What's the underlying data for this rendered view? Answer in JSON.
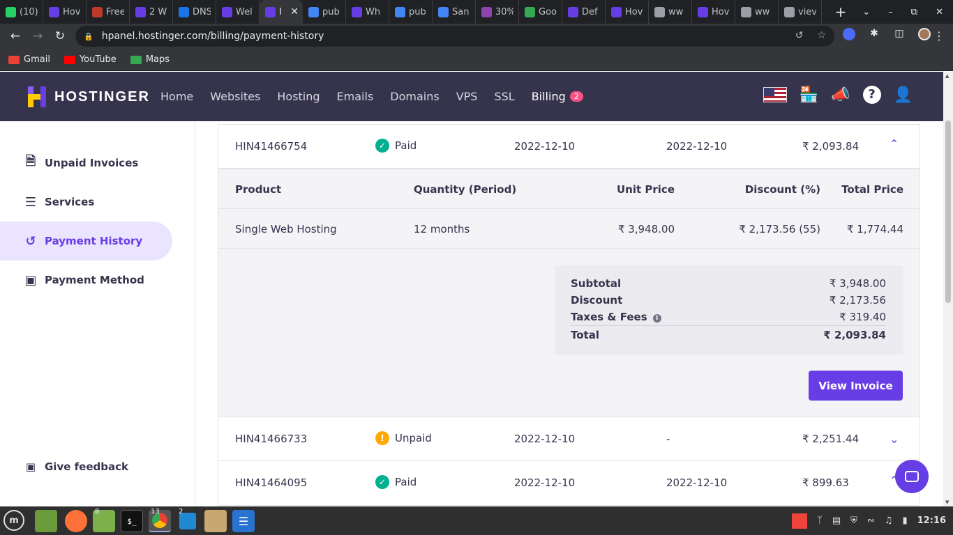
{
  "browser": {
    "tabs": [
      {
        "label": "(10)",
        "fav": "whatsapp-icon",
        "color": "#25d366"
      },
      {
        "label": "Hov",
        "fav": "hostinger-icon",
        "color": "#673de6"
      },
      {
        "label": "Free",
        "fav": "generic-icon",
        "color": "#c0392b"
      },
      {
        "label": "2 W",
        "fav": "hostinger-icon",
        "color": "#673de6"
      },
      {
        "label": "DNS",
        "fav": "shield-icon",
        "color": "#1a73e8"
      },
      {
        "label": "Wel",
        "fav": "hostinger-icon",
        "color": "#673de6"
      },
      {
        "label": "I",
        "fav": "hostinger-icon",
        "color": "#673de6",
        "active": true
      },
      {
        "label": "pub",
        "fav": "globe-icon",
        "color": "#4285f4"
      },
      {
        "label": "Wh",
        "fav": "hostinger-icon",
        "color": "#673de6"
      },
      {
        "label": "pub",
        "fav": "globe-icon",
        "color": "#4285f4"
      },
      {
        "label": "San",
        "fav": "globe-icon",
        "color": "#4285f4"
      },
      {
        "label": "30%",
        "fav": "triangle-icon",
        "color": "#8e44ad"
      },
      {
        "label": "Goo",
        "fav": "google-icon",
        "color": "#34a853"
      },
      {
        "label": "Def",
        "fav": "hostinger-icon",
        "color": "#673de6"
      },
      {
        "label": "Hov",
        "fav": "hostinger-icon",
        "color": "#673de6"
      },
      {
        "label": "ww",
        "fav": "globe-icon",
        "color": "#9aa0a6"
      },
      {
        "label": "Hov",
        "fav": "hostinger-icon",
        "color": "#673de6"
      },
      {
        "label": "ww",
        "fav": "globe-icon",
        "color": "#9aa0a6"
      },
      {
        "label": "viev",
        "fav": "globe-icon",
        "color": "#9aa0a6"
      }
    ],
    "url": "hpanel.hostinger.com/billing/payment-history",
    "bookmarks": [
      {
        "label": "Gmail",
        "color": "#ea4335"
      },
      {
        "label": "YouTube",
        "color": "#ff0000"
      },
      {
        "label": "Maps",
        "color": "#34a853"
      }
    ]
  },
  "header": {
    "logo": "HOSTINGER",
    "nav": [
      "Home",
      "Websites",
      "Hosting",
      "Emails",
      "Domains",
      "VPS",
      "SSL"
    ],
    "billing_label": "Billing",
    "billing_badge": "2"
  },
  "sidebar": {
    "items": [
      {
        "label": "Unpaid Invoices",
        "icon": "document-icon"
      },
      {
        "label": "Services",
        "icon": "list-icon"
      },
      {
        "label": "Payment History",
        "icon": "history-icon",
        "active": true
      },
      {
        "label": "Payment Method",
        "icon": "wallet-icon"
      }
    ],
    "feedback": "Give feedback"
  },
  "invoices": [
    {
      "id": "HIN41466754",
      "status": "Paid",
      "date1": "2022-12-10",
      "date2": "2022-12-10",
      "amount": "₹ 2,093.84",
      "expanded": true
    },
    {
      "id": "HIN41466733",
      "status": "Unpaid",
      "date1": "2022-12-10",
      "date2": "-",
      "amount": "₹ 2,251.44"
    },
    {
      "id": "HIN41464095",
      "status": "Paid",
      "date1": "2022-12-10",
      "date2": "2022-12-10",
      "amount": "₹ 899.63"
    }
  ],
  "detail": {
    "headers": {
      "product": "Product",
      "quantity": "Quantity (Period)",
      "unit": "Unit Price",
      "discount": "Discount (%)",
      "total": "Total Price"
    },
    "row": {
      "product": "Single Web Hosting",
      "quantity": "12 months",
      "unit": "₹ 3,948.00",
      "discount": "₹ 2,173.56 (55)",
      "total": "₹ 1,774.44"
    },
    "summary": {
      "subtotal_label": "Subtotal",
      "subtotal": "₹ 3,948.00",
      "discount_label": "Discount",
      "discount": "₹ 2,173.56",
      "taxes_label": "Taxes & Fees",
      "taxes": "₹ 319.40",
      "total_label": "Total",
      "total": "₹ 2,093.84"
    },
    "button": "View Invoice"
  },
  "taskbar": {
    "badges": {
      "files": "8",
      "chrome": "13",
      "vscode": "2"
    },
    "clock": "12:16"
  }
}
